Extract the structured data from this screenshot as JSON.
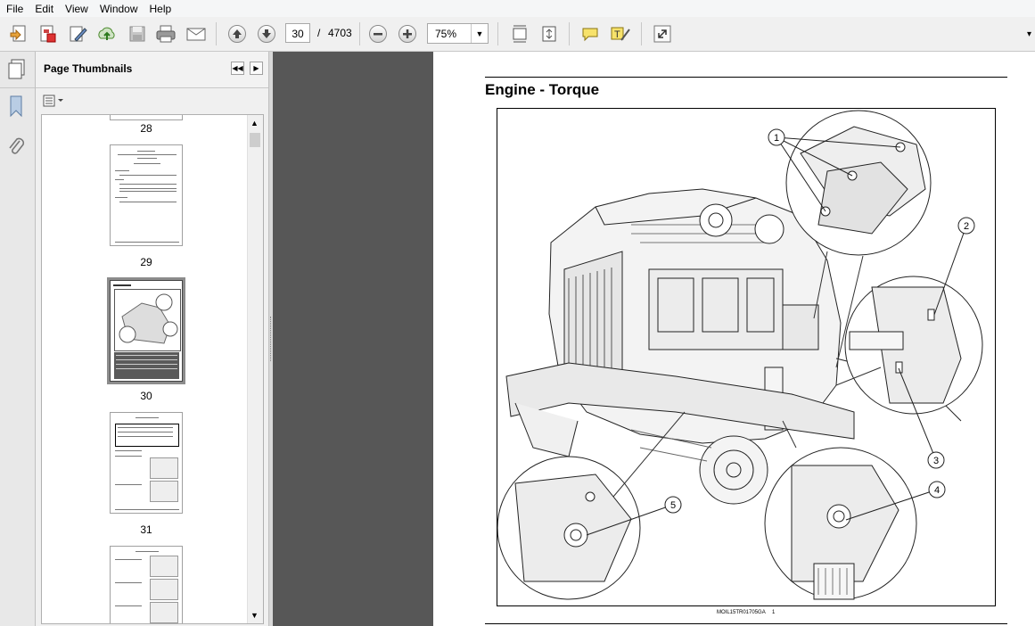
{
  "menu": [
    "File",
    "Edit",
    "View",
    "Window",
    "Help"
  ],
  "toolbar": {
    "current_page": "30",
    "page_separator": "/",
    "total_pages": "4703",
    "zoom": "75%"
  },
  "sidebar": {
    "title": "Page Thumbnails",
    "thumbnails": [
      {
        "label": "28"
      },
      {
        "label": "29"
      },
      {
        "label": "30",
        "selected": true
      },
      {
        "label": "31"
      }
    ]
  },
  "document": {
    "heading": "Engine - Torque",
    "figure_id": "MOIL15TR01705GA",
    "figure_number": "1",
    "callouts": [
      "1",
      "2",
      "3",
      "4",
      "5"
    ]
  },
  "colors": {
    "workspace": "#575757",
    "page": "#ffffff",
    "selected_thumb": "#8c8c8c"
  }
}
